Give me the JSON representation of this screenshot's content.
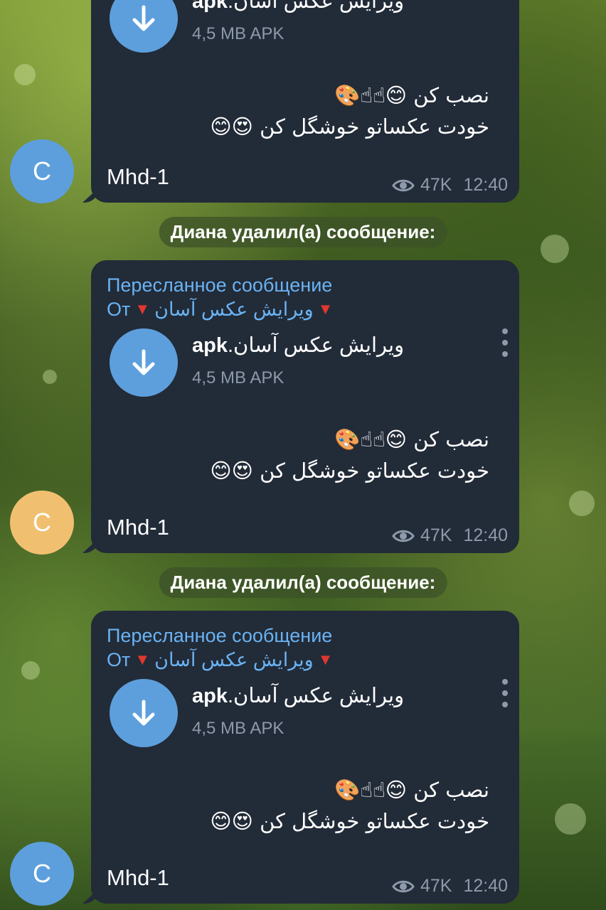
{
  "messages": [
    {
      "forwarded_label": "",
      "forwarded_from_prefix": "",
      "forwarded_from_name": "",
      "file_name": "ویرایش عکس آسان.",
      "file_ext": "apk",
      "file_meta": "4,5 MB APK",
      "caption_line1": "نصب کن 😊☝☝🎨",
      "caption_line2": "خودت عکساتو خوشگل کن 😍😊",
      "sender": "Mhd-1",
      "views": "47K",
      "time": "12:40",
      "avatar_letter": "C",
      "avatar_color": "#5d9fdc"
    },
    {
      "forwarded_label": "Пересланное сообщение",
      "forwarded_from_prefix": "От",
      "forwarded_from_name": "ویرایش عکس آسان",
      "file_name": "ویرایش عکس آسان.",
      "file_ext": "apk",
      "file_meta": "4,5 MB APK",
      "caption_line1": "نصب کن 😊☝☝🎨",
      "caption_line2": "خودت عکساتو خوشگل کن 😍😊",
      "sender": "Mhd-1",
      "views": "47K",
      "time": "12:40",
      "avatar_letter": "C",
      "avatar_color": "#f0c070"
    },
    {
      "forwarded_label": "Пересланное сообщение",
      "forwarded_from_prefix": "От",
      "forwarded_from_name": "ویرایش عکس آسان",
      "file_name": "ویرایش عکس آسان.",
      "file_ext": "apk",
      "file_meta": "4,5 MB APK",
      "caption_line1": "نصب کن 😊☝☝🎨",
      "caption_line2": "خودت عکساتو خوشگل کن 😍😊",
      "sender": "Mhd-1",
      "views": "47K",
      "time": "12:40",
      "avatar_letter": "C",
      "avatar_color": "#5d9fdc"
    }
  ],
  "service_messages": [
    "Диана удалил(а) сообщение:",
    "Диана удалил(а) сообщение:"
  ],
  "colors": {
    "bubble": "#222b38",
    "link": "#6ab3f3",
    "download_button": "#5d9fdc",
    "secondary_text": "#8d9aab"
  }
}
